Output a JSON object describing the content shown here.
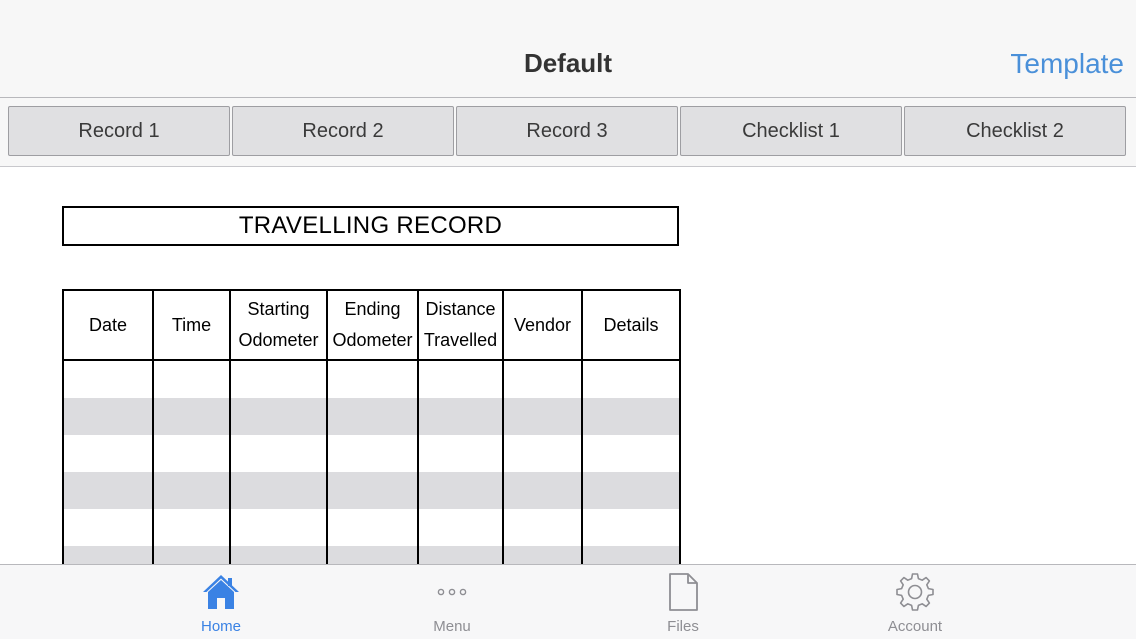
{
  "header": {
    "title": "Default",
    "right_button": "Template"
  },
  "tabs": [
    {
      "label": "Record 1"
    },
    {
      "label": "Record 2"
    },
    {
      "label": "Record 3"
    },
    {
      "label": "Checklist 1"
    },
    {
      "label": "Checklist 2"
    }
  ],
  "document": {
    "title": "TRAVELLING RECORD",
    "columns": [
      {
        "line1": "Date",
        "line2": ""
      },
      {
        "line1": "Time",
        "line2": ""
      },
      {
        "line1": "Starting",
        "line2": "Odometer"
      },
      {
        "line1": "Ending",
        "line2": "Odometer"
      },
      {
        "line1": "Distance",
        "line2": "Travelled"
      },
      {
        "line1": "Vendor",
        "line2": ""
      },
      {
        "line1": "Details",
        "line2": ""
      }
    ]
  },
  "tabbar": {
    "items": [
      {
        "label": "Home",
        "icon": "home-icon",
        "active": true
      },
      {
        "label": "Menu",
        "icon": "more-dots-icon",
        "active": false
      },
      {
        "label": "Files",
        "icon": "file-icon",
        "active": false
      },
      {
        "label": "Account",
        "icon": "gear-icon",
        "active": false
      }
    ]
  },
  "colors": {
    "accent": "#3a82e4",
    "link": "#4a90d9",
    "inactive": "#8e8e93",
    "row_stripe": "#dcdcdf"
  }
}
